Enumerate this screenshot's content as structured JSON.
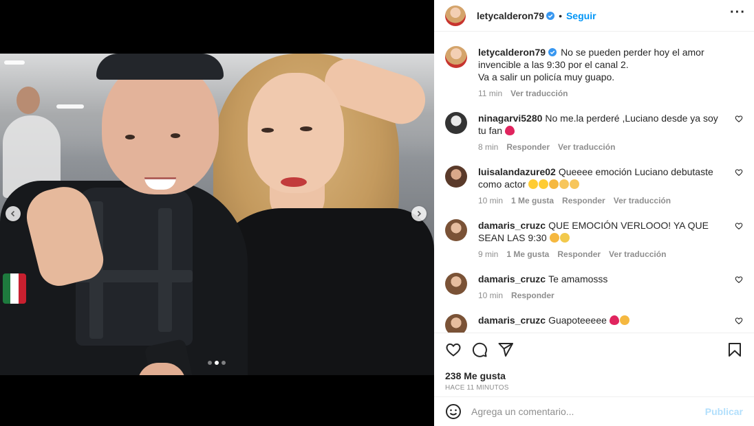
{
  "post": {
    "username": "letycalderon79",
    "follow_label": "Seguir",
    "more_icon": "more-options-icon",
    "accent_color": "#0095f6",
    "caption": {
      "username": "letycalderon79",
      "line1": "No se pueden perder hoy el amor invencible a las 9:30 por el canal 2.",
      "line2": "Va a salir un policía muy guapo.",
      "time": "11 min",
      "translate": "Ver traducción"
    },
    "carousel": {
      "total": 3,
      "active_index": 2
    }
  },
  "comments": [
    {
      "username": "ninagarvi5280",
      "text": "No me.la perderé ,Luciano desde ya soy tu fan",
      "emojis": [
        "red-heart"
      ],
      "time": "8 min",
      "likes": "",
      "reply": "Responder",
      "translate": "Ver traducción"
    },
    {
      "username": "luisalandazure02",
      "text": "Queeee emoción Luciano debutaste como actor",
      "emojis": [
        "heart-eyes",
        "heart-eyes",
        "hands-over-mouth",
        "clapping-hands",
        "clapping-hands"
      ],
      "time": "10 min",
      "likes": "1 Me gusta",
      "reply": "Responder",
      "translate": "Ver traducción"
    },
    {
      "username": "damaris_cruzc",
      "text": "QUE EMOCIÓN VERLOOO! YA QUE SEAN LAS 9:30",
      "emojis": [
        "hands-over-mouth",
        "sparkles"
      ],
      "time": "9 min",
      "likes": "1 Me gusta",
      "reply": "Responder",
      "translate": "Ver traducción"
    },
    {
      "username": "damaris_cruzc",
      "text": "Te amamosss",
      "emojis": [],
      "time": "10 min",
      "likes": "",
      "reply": "Responder",
      "translate": ""
    },
    {
      "username": "damaris_cruzc",
      "text": "Guapoteeeee",
      "emojis": [
        "red-heart",
        "hands-over-mouth"
      ],
      "time": "",
      "likes": "",
      "reply": "",
      "translate": ""
    }
  ],
  "actions": {
    "likes": "238 Me gusta",
    "time_ago": "HACE 11 MINUTOS"
  },
  "add_comment": {
    "placeholder": "Agrega un comentario...",
    "publish_label": "Publicar",
    "publish_color": "#b2dffc"
  }
}
